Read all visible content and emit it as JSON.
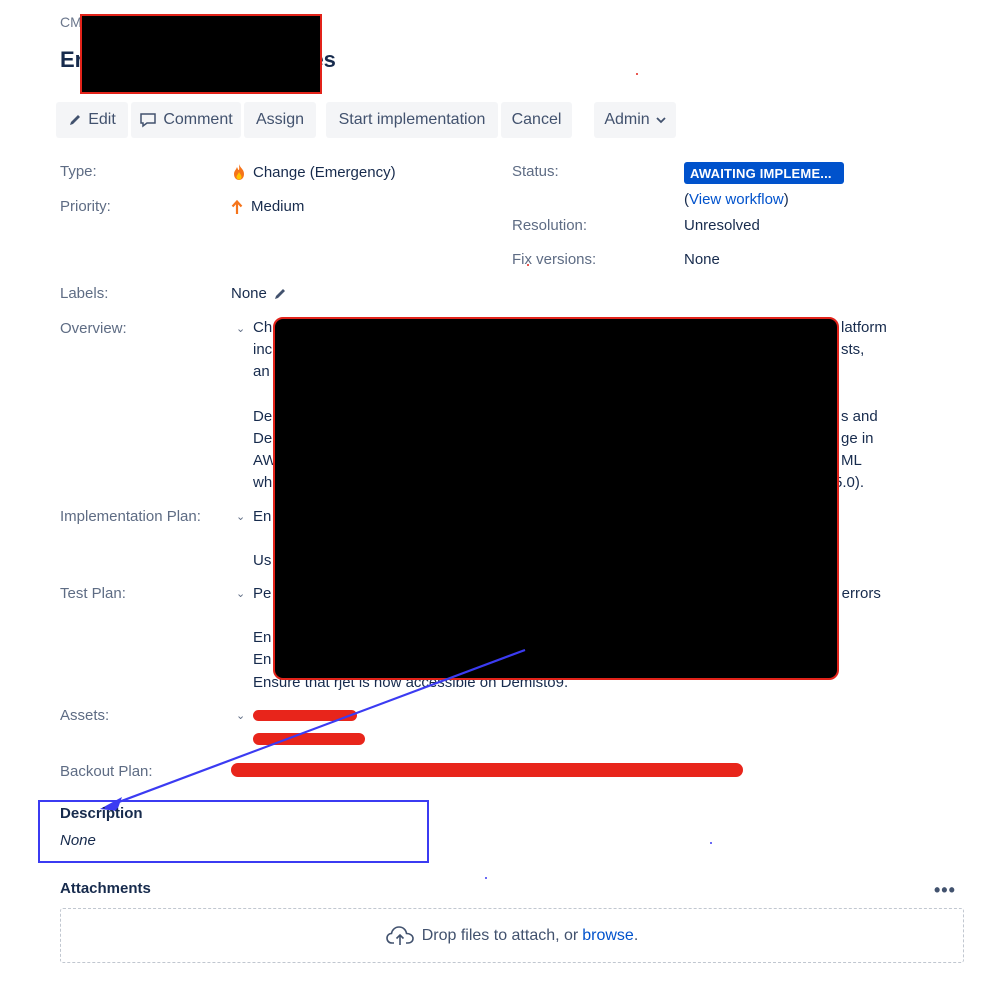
{
  "breadcrumb": "CM",
  "title": {
    "start": "Er",
    "end": "ges"
  },
  "toolbar": {
    "edit": "Edit",
    "comment": "Comment",
    "assign": "Assign",
    "start_impl": "Start implementation",
    "cancel": "Cancel",
    "admin": "Admin"
  },
  "fields": {
    "type_label": "Type:",
    "type_value": "Change (Emergency)",
    "priority_label": "Priority:",
    "priority_value": "Medium",
    "status_label": "Status:",
    "status_value": "AWAITING IMPLEME...",
    "view_workflow": "View workflow",
    "resolution_label": "Resolution:",
    "resolution_value": "Unresolved",
    "fix_label": "Fix versions:",
    "fix_value": "None",
    "labels_label": "Labels:",
    "labels_value": "None",
    "overview_label": "Overview:",
    "impl_label": "Implementation Plan:",
    "test_label": "Test Plan:",
    "assets_label": "Assets:",
    "backout_label": "Backout Plan:"
  },
  "overview_fragments": {
    "l1_start": "Ch",
    "l1_end": "latform",
    "l2_start": "inc",
    "l2_end": "sts,",
    "l3_start": "an",
    "l4_start": "De",
    "l4_end": "s and",
    "l5_start": "De",
    "l5_end": "ge in",
    "l6_start": "AW",
    "l6_end": "ML",
    "l7_start": "wh",
    "l7_end": "5.0)."
  },
  "impl_fragments": {
    "l1": "En",
    "l2": "Us"
  },
  "test_fragments": {
    "l1_start": "Pe",
    "l1_end": "y errors",
    "l2": "En",
    "l3": "En",
    "l4": "Ensure that rjet is now accessible on Demisto9."
  },
  "description": {
    "title": "Description",
    "value": "None"
  },
  "attachments": {
    "title": "Attachments",
    "drop_text": "Drop files to attach, or",
    "browse": "browse",
    "browse_suffix": "."
  },
  "colors": {
    "primary": "#0052cc",
    "redaction": "#000000",
    "annotation_red": "#e2231a",
    "annotation_blue": "#3b3bf2"
  }
}
